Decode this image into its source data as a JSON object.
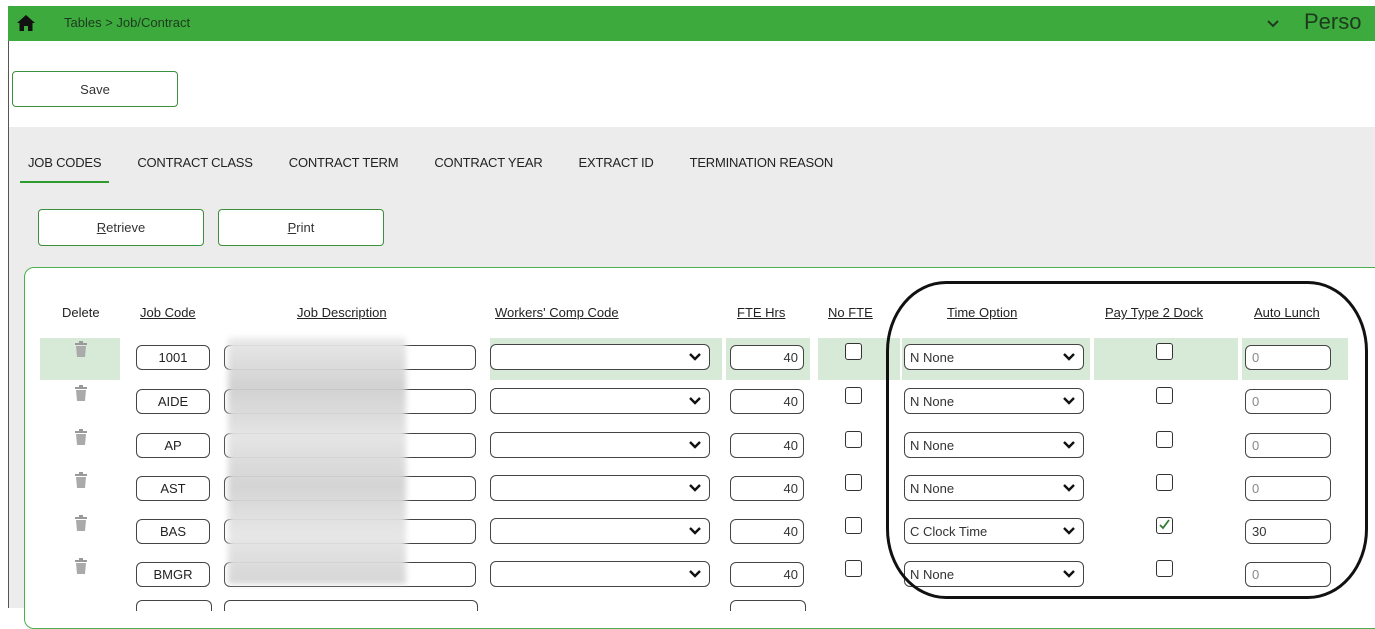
{
  "header": {
    "breadcrumb": "Tables > Job/Contract",
    "persona_label": "Perso",
    "brand_color": "#3daa3d",
    "home_icon": "home-icon",
    "menu_icon": "chevron-down-icon"
  },
  "toolbar": {
    "save_label": "Save"
  },
  "tabs": [
    {
      "label": "JOB CODES",
      "active": true
    },
    {
      "label": "CONTRACT CLASS"
    },
    {
      "label": "CONTRACT TERM"
    },
    {
      "label": "CONTRACT YEAR"
    },
    {
      "label": "EXTRACT ID"
    },
    {
      "label": "TERMINATION REASON"
    }
  ],
  "actions": {
    "retrieve_prefix": "R",
    "retrieve_rest": "etrieve",
    "print_prefix": "P",
    "print_rest": "rint"
  },
  "columns": {
    "delete": "Delete",
    "job_code": "Job Code",
    "job_description": "Job Description",
    "workers_comp": "Workers' Comp Code",
    "fte_hrs": "FTE Hrs",
    "no_fte": "No FTE",
    "time_option": "Time Option",
    "pay_type_dock": "Pay Type 2 Dock",
    "auto_lunch": "Auto Lunch"
  },
  "rows": [
    {
      "code": "1001",
      "fte": "40",
      "no_fte": false,
      "time_option": "N None",
      "pay_dock": false,
      "auto_lunch": "0"
    },
    {
      "code": "AIDE",
      "fte": "40",
      "no_fte": false,
      "time_option": "N None",
      "pay_dock": false,
      "auto_lunch": "0"
    },
    {
      "code": "AP",
      "fte": "40",
      "no_fte": false,
      "time_option": "N None",
      "pay_dock": false,
      "auto_lunch": "0"
    },
    {
      "code": "AST",
      "fte": "40",
      "no_fte": false,
      "time_option": "N None",
      "pay_dock": false,
      "auto_lunch": "0"
    },
    {
      "code": "BAS",
      "fte": "40",
      "no_fte": false,
      "time_option": "C Clock Time",
      "pay_dock": true,
      "auto_lunch": "30"
    },
    {
      "code": "BMGR",
      "fte": "40",
      "no_fte": false,
      "time_option": "N None",
      "pay_dock": false,
      "auto_lunch": "0"
    }
  ]
}
